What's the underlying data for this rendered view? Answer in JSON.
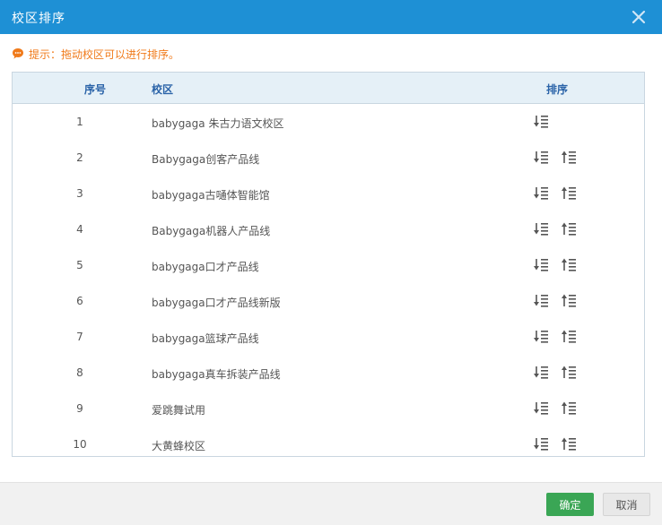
{
  "dialog": {
    "title": "校区排序",
    "hint": "提示：拖动校区可以进行排序。"
  },
  "table": {
    "headers": {
      "no": "序号",
      "name": "校区",
      "sort": "排序"
    },
    "rows": [
      {
        "no": "1",
        "name": "babygaga 朱古力语文校区"
      },
      {
        "no": "2",
        "name": "Babygaga创客产品线"
      },
      {
        "no": "3",
        "name": "babygaga古嗵体智能馆"
      },
      {
        "no": "4",
        "name": "Babygaga机器人产品线"
      },
      {
        "no": "5",
        "name": "babygaga口才产品线"
      },
      {
        "no": "6",
        "name": "babygaga口才产品线新版"
      },
      {
        "no": "7",
        "name": "babygaga篮球产品线"
      },
      {
        "no": "8",
        "name": "babygaga真车拆装产品线"
      },
      {
        "no": "9",
        "name": "爱跳舞试用"
      },
      {
        "no": "10",
        "name": "大黄蜂校区"
      }
    ]
  },
  "footer": {
    "ok_label": "确定",
    "cancel_label": "取消"
  },
  "colors": {
    "titlebar": "#1e90d5",
    "hint": "#f07a1a",
    "header_bg": "#e5f0f7",
    "ok": "#3aa655"
  },
  "icons": {
    "close": "close-icon",
    "hint": "chat-bubble-icon",
    "move_down": "sort-down-icon",
    "move_up": "sort-up-icon"
  }
}
